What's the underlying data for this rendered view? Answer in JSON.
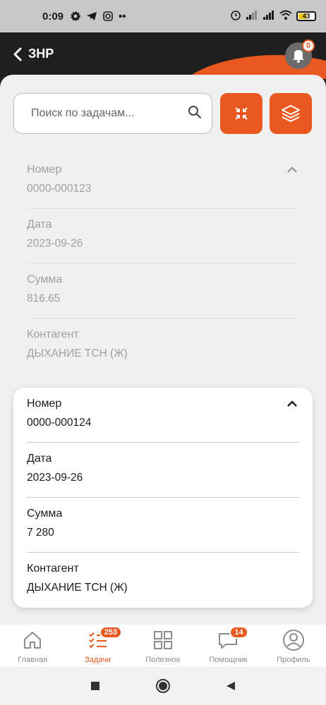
{
  "status_bar": {
    "time": "0:09",
    "battery": "43"
  },
  "header": {
    "title": "ЗНР",
    "notification_count": "0"
  },
  "search": {
    "placeholder": "Поиск по задачам..."
  },
  "cards": [
    {
      "state": "collapsed-faded",
      "fields": [
        {
          "label": "Номер",
          "value": "0000-000123"
        },
        {
          "label": "Дата",
          "value": "2023-09-26"
        },
        {
          "label": "Сумма",
          "value": "816.65"
        },
        {
          "label": "Контагент",
          "value": "ДЫХАНИЕ ТСН (Ж)"
        }
      ]
    },
    {
      "state": "active",
      "fields": [
        {
          "label": "Номер",
          "value": "0000-000124"
        },
        {
          "label": "Дата",
          "value": "2023-09-26"
        },
        {
          "label": "Сумма",
          "value": "7 280"
        },
        {
          "label": "Контагент",
          "value": "ДЫХАНИЕ ТСН (Ж)"
        }
      ]
    }
  ],
  "bottom_nav": [
    {
      "label": "Главная",
      "icon": "home-icon",
      "badge": null,
      "active": false
    },
    {
      "label": "Задачи",
      "icon": "tasks-icon",
      "badge": "253",
      "active": true
    },
    {
      "label": "Полезное",
      "icon": "grid-icon",
      "badge": null,
      "active": false
    },
    {
      "label": "Помощник",
      "icon": "chat-icon",
      "badge": "14",
      "active": false
    },
    {
      "label": "Профиль",
      "icon": "profile-icon",
      "badge": null,
      "active": false
    }
  ],
  "colors": {
    "accent": "#e9581f",
    "header_bg": "#1f1f1f",
    "content_bg": "#f0f0f0"
  }
}
